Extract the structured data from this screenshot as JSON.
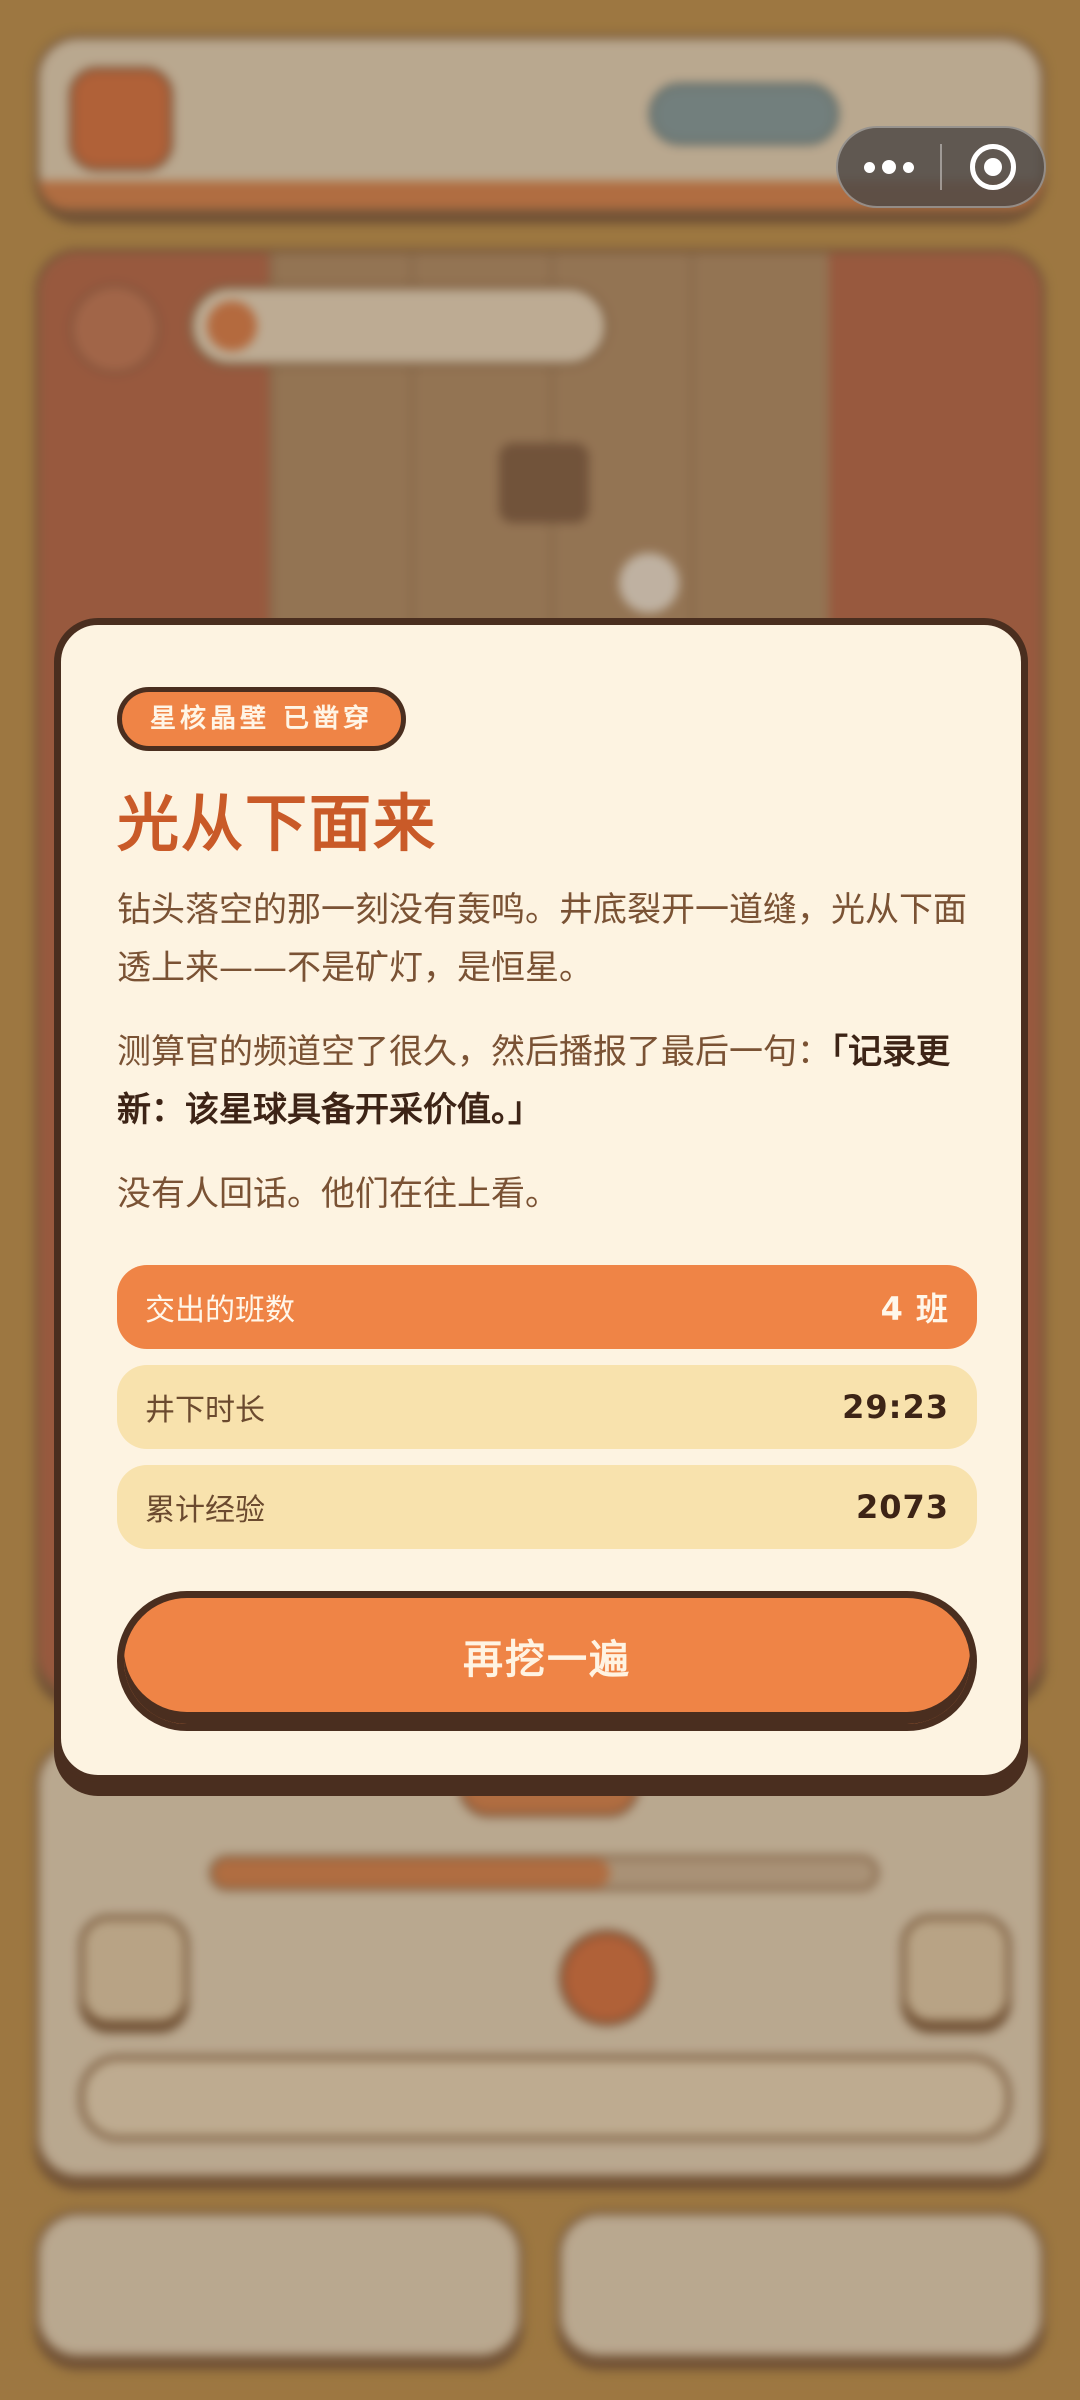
{
  "capsule": {
    "more_icon": "more-dots-icon",
    "close_icon": "target-circle-icon"
  },
  "modal": {
    "badge": "星核晶壁 已凿穿",
    "title": "光从下面来",
    "paragraph1": "钻头落空的那一刻没有轰鸣。井底裂开一道缝，光从下面透上来——不是矿灯，是恒星。",
    "paragraph2_intro": "测算官的频道空了很久，然后播报了最后一句：",
    "paragraph2_quote": "「记录更新：该星球具备开采价值。」",
    "paragraph3": "没有人回话。他们在往上看。",
    "stats": [
      {
        "label": "交出的班数",
        "value": "4 班"
      },
      {
        "label": "井下时长",
        "value": "29:23"
      },
      {
        "label": "累计经验",
        "value": "2073"
      }
    ],
    "button_label": "再挖一遍"
  },
  "colors": {
    "accent": "#ef8446",
    "title": "#c95a28",
    "card_bg": "#fdf3e1",
    "border": "#4a2e1f",
    "stat_bg": "#f8e2ad"
  }
}
